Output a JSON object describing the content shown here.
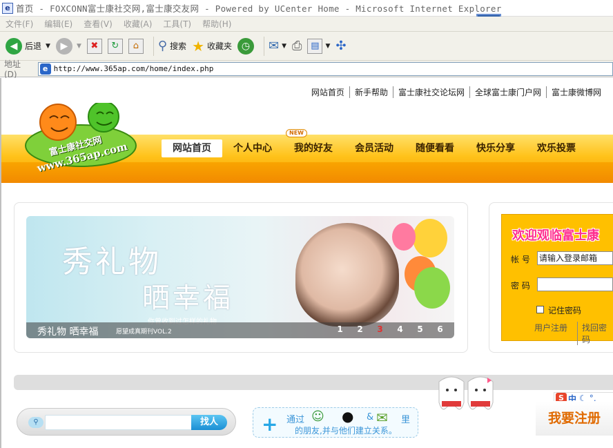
{
  "window": {
    "title": "首页 - FOXCONN富士康社交网,富士康交友网 - Powered by UCenter Home - Microsoft Internet Explorer"
  },
  "menubar": {
    "items": [
      "文件(F)",
      "编辑(E)",
      "查看(V)",
      "收藏(A)",
      "工具(T)",
      "帮助(H)"
    ]
  },
  "toolbar": {
    "back_label": "后退",
    "search_label": "搜索",
    "favorites_label": "收藏夹"
  },
  "addressbar": {
    "label": "地址(D)",
    "url": "http://www.365ap.com/home/index.php"
  },
  "site": {
    "logo_text": "富士康社交网",
    "logo_url": "www.365ap.com",
    "toplinks": [
      "网站首页",
      "新手帮助",
      "富士康社交论坛网",
      "全球富士康门户网",
      "富士康微博网"
    ],
    "nav": [
      "网站首页",
      "个人中心",
      "我的好友",
      "会员活动",
      "随便看看",
      "快乐分享",
      "欢乐投票"
    ],
    "nav_new_badge": "NEW",
    "accent_color": "#ffc000"
  },
  "banner": {
    "headline1": "秀礼物",
    "headline2": "晒幸福",
    "small_text": "你曾收到过怎样的礼物",
    "caption": "秀礼物 晒幸福",
    "caption_sub": "愿望成真期刊VOL.2",
    "pages": [
      "1",
      "2",
      "3",
      "4",
      "5",
      "6"
    ],
    "active_page": "3"
  },
  "login": {
    "welcome": "欢迎观临富士康",
    "account_label": "帐 号",
    "account_placeholder": "请输入登录邮箱",
    "password_label": "密 码",
    "remember_label": "记住密码",
    "register_link": "用户注册",
    "forgot_link": "找回密码"
  },
  "search": {
    "button_label": "找人"
  },
  "invite": {
    "line1": "通过",
    "amp": "&",
    "li": "里",
    "line2": "的朋友,并与他们建立关系。"
  },
  "register": {
    "label": "我要注册"
  },
  "ime": {
    "logo": "S",
    "mode": "中"
  }
}
